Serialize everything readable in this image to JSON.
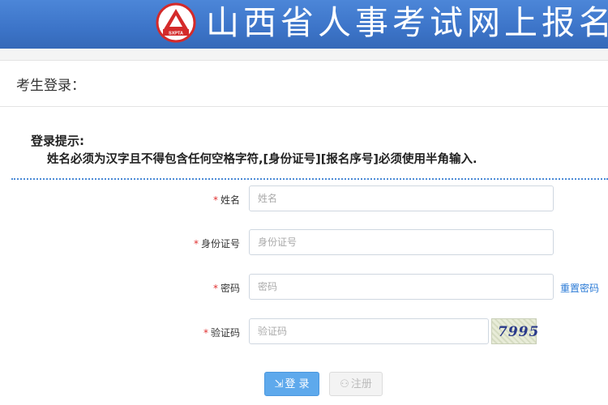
{
  "header": {
    "title": "山西省人事考试网上报名",
    "logo_text": "SXPTA",
    "brand_color": "#3c74c8",
    "logo_color": "#d42a2a"
  },
  "section": {
    "title": "考生登录："
  },
  "hint": {
    "title": "登录提示:",
    "text": "姓名必须为汉字且不得包含任何空格字符,[身份证号][报名序号]必须使用半角输入."
  },
  "form": {
    "required_mark": "*",
    "name": {
      "label": "姓名",
      "placeholder": "姓名",
      "value": ""
    },
    "id_number": {
      "label": "身份证号",
      "placeholder": "身份证号",
      "value": ""
    },
    "password": {
      "label": "密码",
      "placeholder": "密码",
      "value": ""
    },
    "captcha": {
      "label": "验证码",
      "placeholder": "验证码",
      "value": "",
      "image_text": "7995"
    },
    "reset_password_link": "重置密码"
  },
  "buttons": {
    "login_icon": "login-icon",
    "login_glyph": "⇲",
    "login_label": "登 录",
    "register_icon": "register-icon",
    "register_glyph": "⚇",
    "register_label": "注册"
  }
}
